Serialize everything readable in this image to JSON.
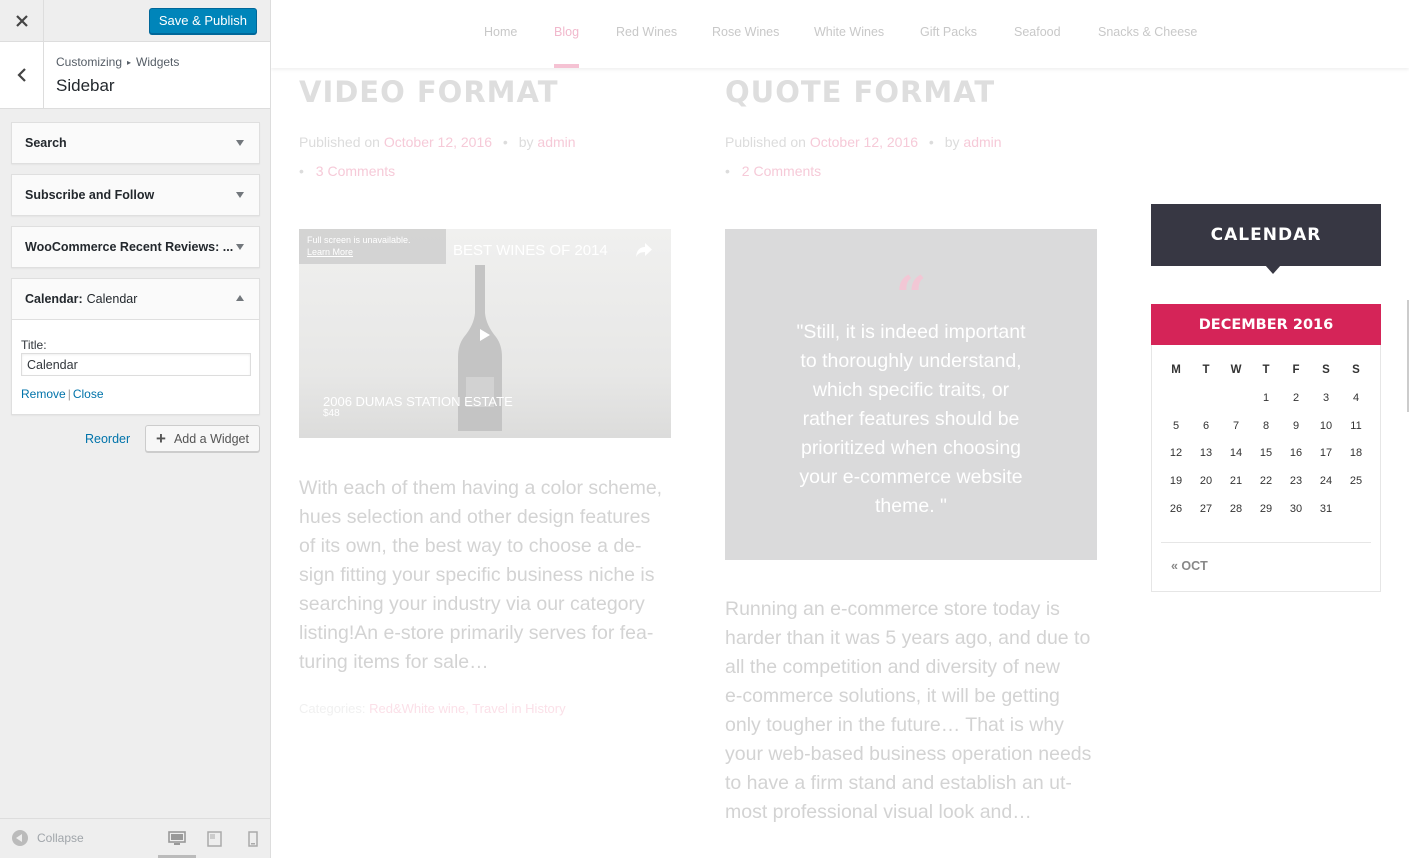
{
  "customizer": {
    "save_label": "Save & Publish",
    "breadcrumb_root": "Customizing",
    "breadcrumb_sep": "▸",
    "breadcrumb_current": "Widgets",
    "section_title": "Sidebar",
    "widgets": [
      {
        "title": "Search",
        "subtitle": ""
      },
      {
        "title": "Subscribe and Follow",
        "subtitle": ""
      },
      {
        "title": "WooCommerce Recent Reviews: ...",
        "subtitle": ""
      },
      {
        "title": "Calendar:",
        "subtitle": "Calendar"
      }
    ],
    "calendar_form": {
      "title_label": "Title:",
      "title_value": "Calendar",
      "remove": "Remove",
      "separator": "|",
      "close": "Close"
    },
    "reorder": "Reorder",
    "add_widget": "Add a Widget",
    "collapse": "Collapse"
  },
  "nav": {
    "items": [
      "Home",
      "Blog",
      "Red Wines",
      "Rose Wines",
      "White Wines",
      "Gift Packs",
      "Seafood",
      "Snacks & Cheese"
    ],
    "active": "Blog"
  },
  "posts": [
    {
      "title": "VIDEO FORMAT",
      "published_prefix": "Published on",
      "date": "October 12, 2016",
      "by": "by",
      "author": "admin",
      "comments": "3 Comments",
      "video": {
        "notice": "Full screen is unavailable.",
        "learn_more": "Learn More",
        "title": "BEST WINES OF 2014",
        "caption": "2006 DUMAS STATION ESTATE",
        "price": "$48"
      },
      "excerpt_lines": [
        "With each of them having a color scheme,",
        "hues selection and other design features",
        "of its own, the best way to choose a de-",
        "sign fitting your specific business niche is",
        "searching your industry via our category",
        "listing!An e-store primarily serves for fea-",
        "turing items for sale…"
      ],
      "categories_label": "Categories:",
      "categories": "Red&White wine, Travel in History"
    },
    {
      "title": "QUOTE FORMAT",
      "published_prefix": "Published on",
      "date": "October 12, 2016",
      "by": "by",
      "author": "admin",
      "comments": "2 Comments",
      "quote_mark": "“",
      "quote_lines": [
        "\"Still, it is indeed important",
        "to thoroughly understand,",
        "which specific traits, or",
        "rather features should be",
        "prioritized when choosing",
        "your e-commerce website",
        "theme. \""
      ],
      "excerpt_lines": [
        "Running an e-commerce store today is",
        "harder than it was 5 years ago, and due to",
        "all the competition and diversity of new",
        "e-commerce solutions, it will be getting",
        "only tougher in the future… That is why",
        "your web-based business operation needs",
        "to have a firm stand and establish an ut-",
        "most professional visual look and…"
      ]
    }
  ],
  "calendar": {
    "heading": "CALENDAR",
    "month": "DECEMBER 2016",
    "weekdays": [
      "M",
      "T",
      "W",
      "T",
      "F",
      "S",
      "S"
    ],
    "weeks": [
      [
        "",
        "",
        "",
        "1",
        "2",
        "3",
        "4"
      ],
      [
        "5",
        "6",
        "7",
        "8",
        "9",
        "10",
        "11"
      ],
      [
        "12",
        "13",
        "14",
        "15",
        "16",
        "17",
        "18"
      ],
      [
        "19",
        "20",
        "21",
        "22",
        "23",
        "24",
        "25"
      ],
      [
        "26",
        "27",
        "28",
        "29",
        "30",
        "31",
        ""
      ]
    ],
    "prev": "« OCT"
  },
  "colors": {
    "accent_blue": "#0085ba",
    "link_blue": "#0073aa",
    "calendar_pink": "#d52458",
    "calendar_dark": "#373743"
  }
}
